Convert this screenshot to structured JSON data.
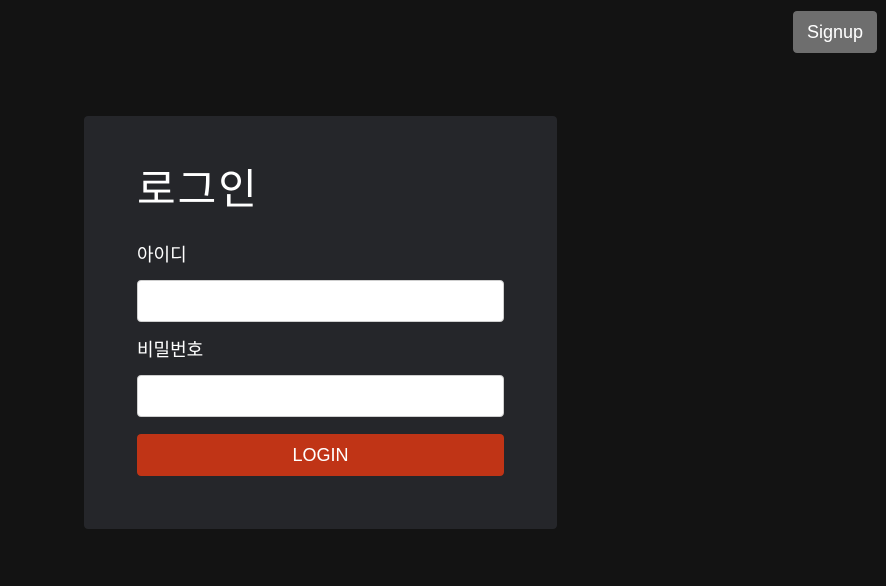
{
  "header": {
    "signup_label": "Signup"
  },
  "login": {
    "title": "로그인",
    "id_label": "아이디",
    "id_value": "",
    "password_label": "비밀번호",
    "password_value": "",
    "submit_label": "LOGIN"
  },
  "colors": {
    "background": "#131313",
    "card": "#25262a",
    "signup_button": "#6e6e6e",
    "login_button": "#c03416",
    "text": "#ffffff"
  }
}
